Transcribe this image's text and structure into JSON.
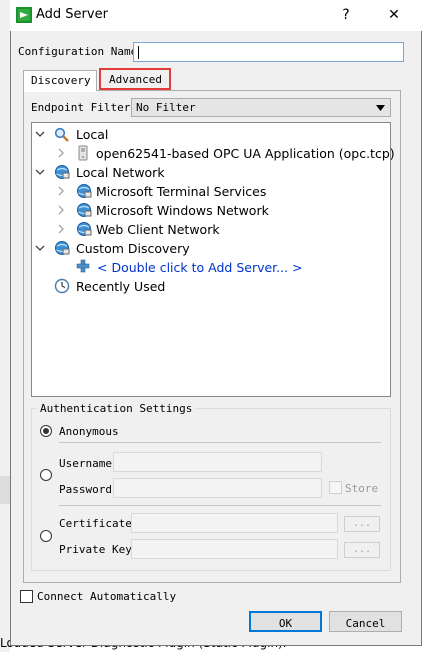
{
  "window": {
    "title": "Add Server",
    "help_glyph": "?",
    "close_glyph": "✕"
  },
  "config": {
    "label": "Configuration Name",
    "value": ""
  },
  "tabs": [
    {
      "label": "Discovery"
    },
    {
      "label": "Advanced"
    }
  ],
  "endpoint_filter": {
    "label": "Endpoint Filter:",
    "value": "No Filter"
  },
  "tree": {
    "local": {
      "label": "Local",
      "children": [
        {
          "label": "open62541-based OPC UA Application (opc.tcp)"
        }
      ]
    },
    "local_network": {
      "label": "Local Network",
      "children": [
        {
          "label": "Microsoft Terminal Services"
        },
        {
          "label": "Microsoft Windows Network"
        },
        {
          "label": "Web Client Network"
        }
      ]
    },
    "custom_discovery": {
      "label": "Custom Discovery",
      "children": [
        {
          "label": "< Double click to Add Server... >"
        }
      ]
    },
    "recently_used": {
      "label": "Recently Used"
    }
  },
  "auth": {
    "title": "Authentication Settings",
    "anonymous": "Anonymous",
    "username_label": "Username",
    "password_label": "Password",
    "store_label": "Store",
    "certificate_label": "Certificate",
    "private_key_label": "Private Key",
    "browse_label": "..."
  },
  "connect_auto": "Connect Automatically",
  "buttons": {
    "ok": "OK",
    "cancel": "Cancel"
  },
  "background": {
    "line1": "Loaded Server Diagnostic Plugin (Static Plugin)."
  },
  "colors": {
    "tab_highlight": "#e23c3c",
    "link_text": "#0033cc",
    "ok_border": "#0078d7"
  }
}
